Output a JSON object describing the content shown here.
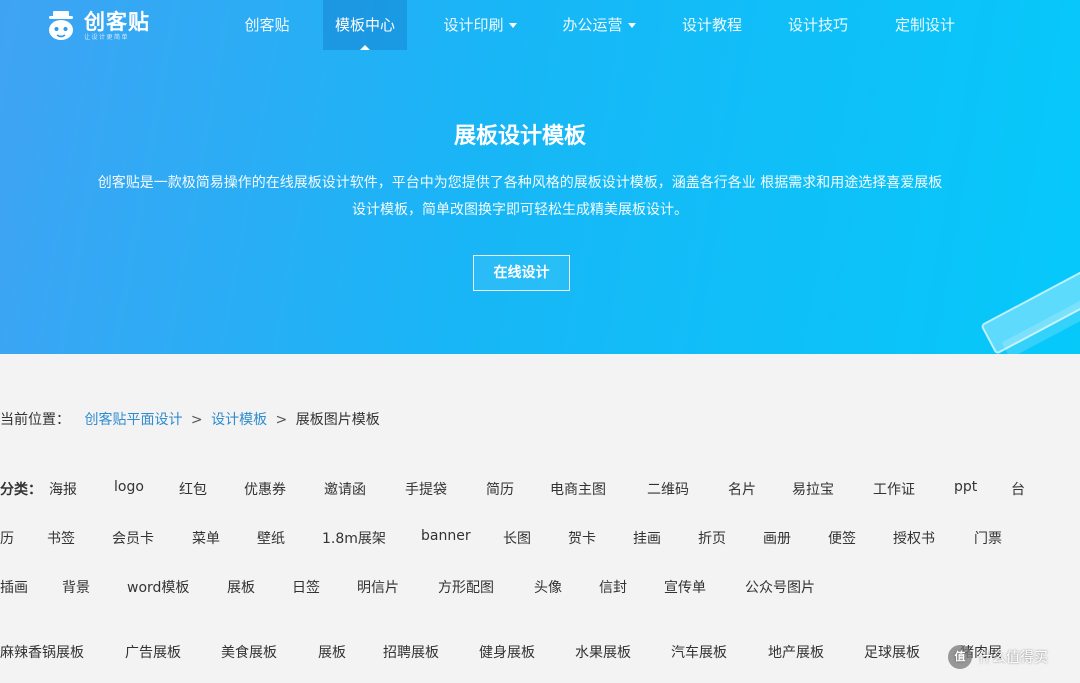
{
  "header": {
    "logo_text": "创客贴",
    "logo_sub": "让设计更简单",
    "nav": [
      {
        "label": "创客贴",
        "active": false,
        "dropdown": false
      },
      {
        "label": "模板中心",
        "active": true,
        "dropdown": false
      },
      {
        "label": "设计印刷",
        "active": false,
        "dropdown": true
      },
      {
        "label": "办公运营",
        "active": false,
        "dropdown": true
      },
      {
        "label": "设计教程",
        "active": false,
        "dropdown": false
      },
      {
        "label": "设计技巧",
        "active": false,
        "dropdown": false
      },
      {
        "label": "定制设计",
        "active": false,
        "dropdown": false
      }
    ]
  },
  "hero": {
    "title": "展板设计模板",
    "desc_line1": "创客贴是一款极简易操作的在线展板设计软件，平台中为您提供了各种风格的展板设计模板，涵盖各行各业 根据需求和用途选择喜爱展板",
    "desc_line2": "设计模板，简单改图换字即可轻松生成精美展板设计。",
    "button": "在线设计"
  },
  "breadcrumb": {
    "prefix": "当前位置：",
    "links": [
      "创客贴平面设计",
      "设计模板"
    ],
    "current": "展板图片模板",
    "separator": ">"
  },
  "categories": {
    "label": "分类：",
    "row1": [
      "海报",
      "logo",
      "红包",
      "优惠券",
      "邀请函",
      "手提袋",
      "简历",
      "电商主图",
      "二维码",
      "名片",
      "易拉宝",
      "工作证",
      "ppt",
      "台"
    ],
    "row2": [
      "历",
      "书签",
      "会员卡",
      "菜单",
      "壁纸",
      "1.8m展架",
      "banner",
      "长图",
      "贺卡",
      "挂画",
      "折页",
      "画册",
      "便签",
      "授权书",
      "门票"
    ],
    "row3": [
      "插画",
      "背景",
      "word模板",
      "展板",
      "日签",
      "明信片",
      "方形配图",
      "头像",
      "信封",
      "宣传单",
      "公众号图片"
    ]
  },
  "subcategories": [
    "麻辣香锅展板",
    "广告展板",
    "美食展板",
    "展板",
    "招聘展板",
    "健身展板",
    "水果展板",
    "汽车展板",
    "地产展板",
    "足球展板",
    "猪肉展"
  ],
  "watermark": {
    "badge": "值",
    "text": "什么值得买"
  }
}
